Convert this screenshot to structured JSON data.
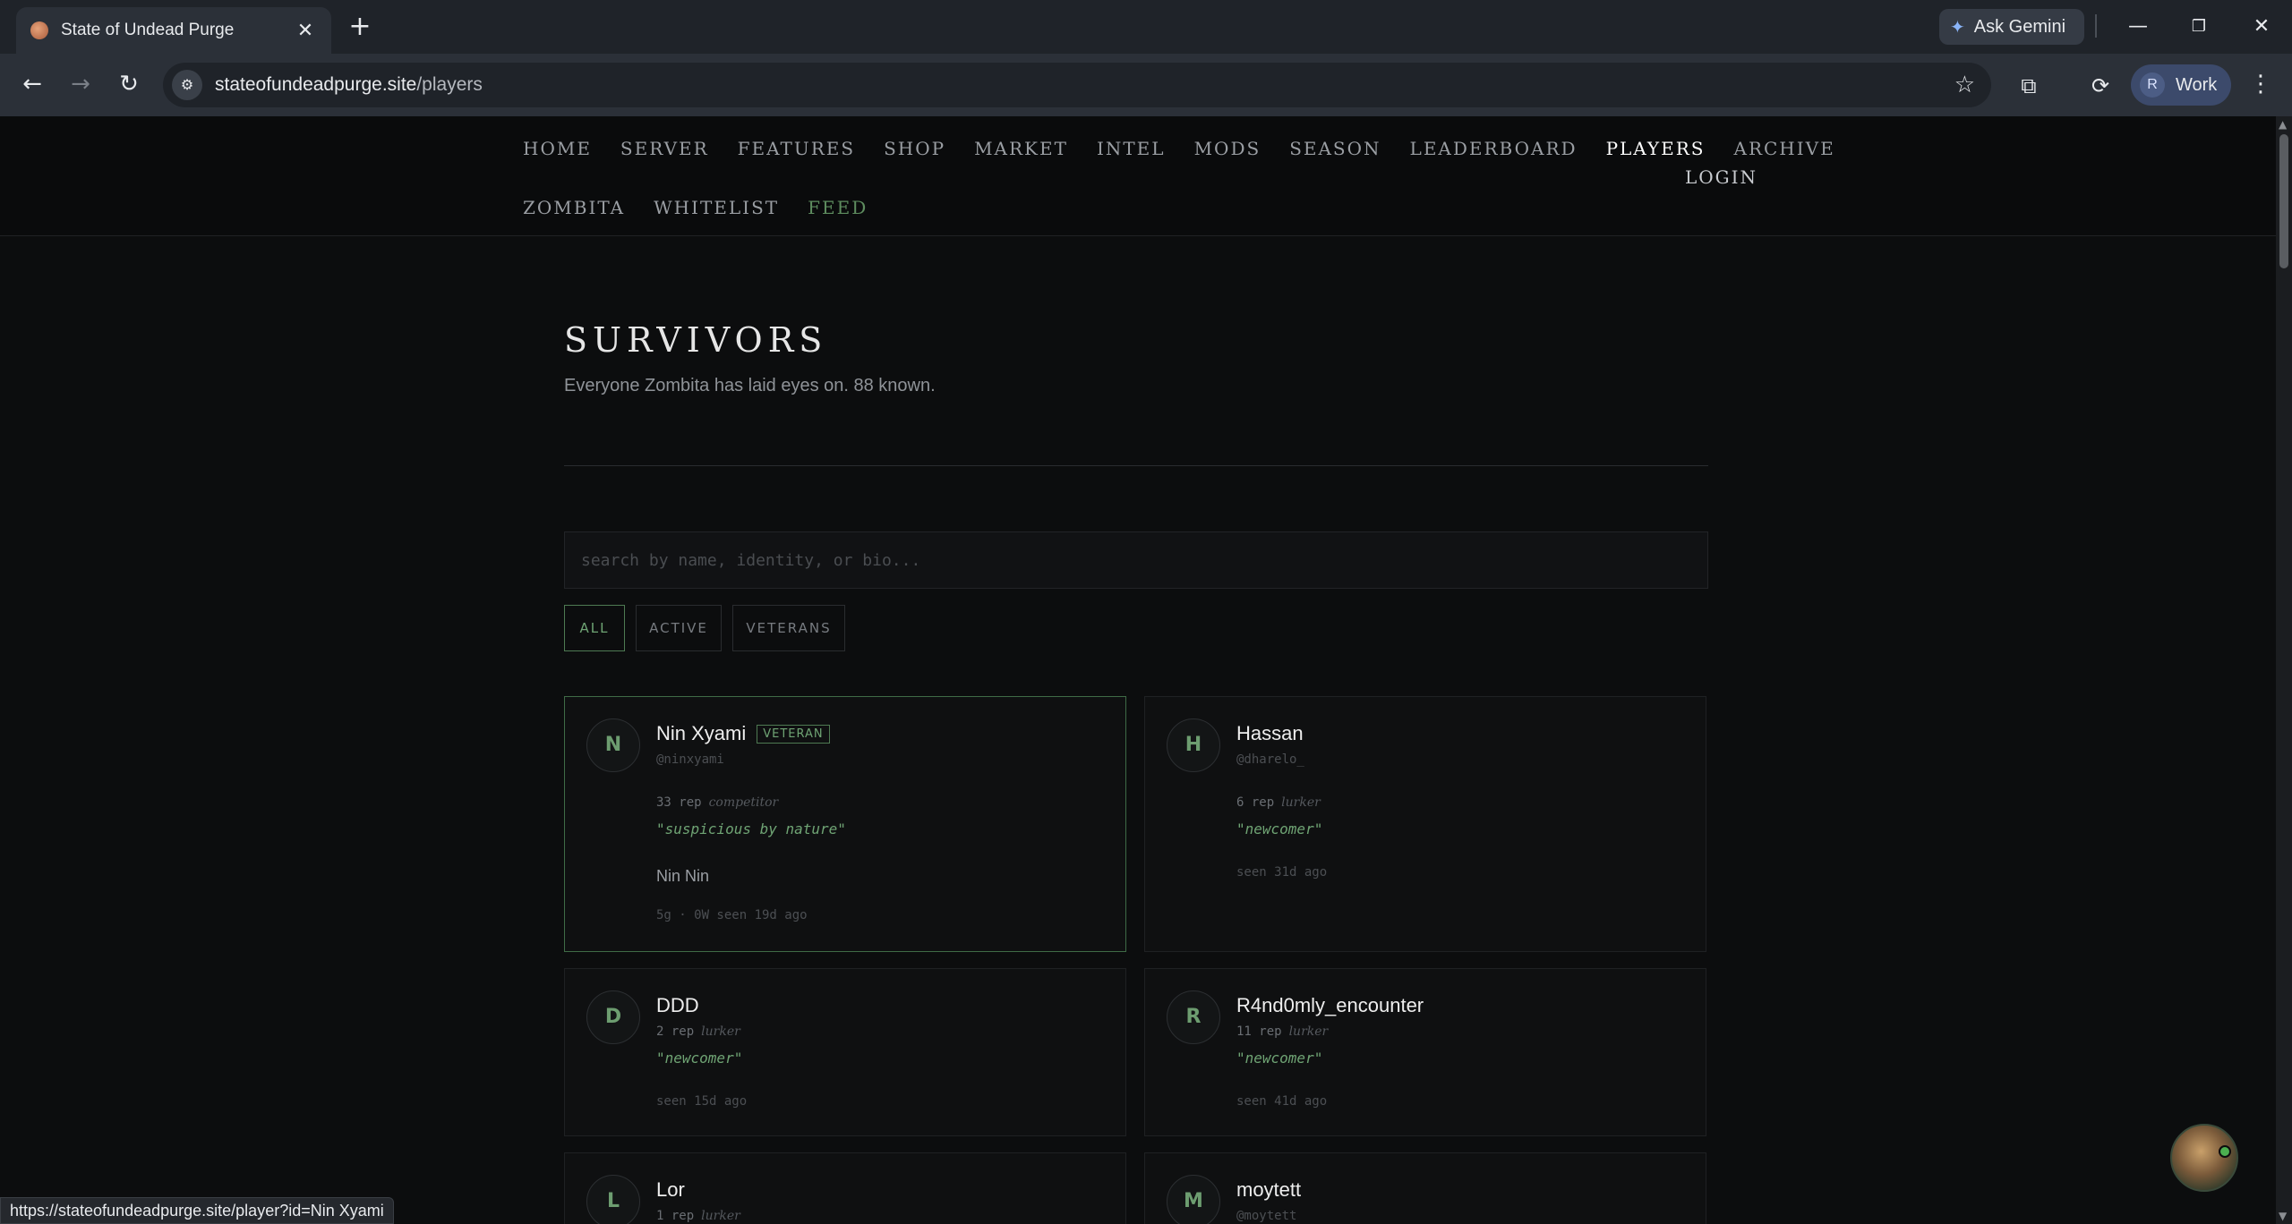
{
  "browser": {
    "tab_title": "State of Undead Purge",
    "url_host": "stateofundeadpurge.site",
    "url_path": "/players",
    "ask_gemini": "Ask Gemini",
    "profile_initial": "R",
    "profile_name": "Work",
    "status_url": "https://stateofundeadpurge.site/player?id=Nin Xyami"
  },
  "nav": {
    "row1": [
      "HOME",
      "SERVER",
      "FEATURES",
      "SHOP",
      "MARKET",
      "INTEL",
      "MODS",
      "SEASON",
      "LEADERBOARD",
      "PLAYERS",
      "ARCHIVE"
    ],
    "row2": [
      "ZOMBITA",
      "WHITELIST",
      "FEED"
    ],
    "login": "LOGIN",
    "active": "PLAYERS"
  },
  "page": {
    "title": "SURVIVORS",
    "subtitle": "Everyone Zombita has laid eyes on. 88 known.",
    "search_placeholder": "search by name, identity, or bio...",
    "filters": [
      "ALL",
      "ACTIVE",
      "VETERANS"
    ],
    "active_filter": "ALL"
  },
  "players": [
    {
      "initial": "N",
      "name": "Nin Xyami",
      "badge": "VETERAN",
      "handle": "@ninxyami",
      "rep": "33 rep",
      "role": "competitor",
      "quote": "\"suspicious by nature\"",
      "bio": "Nin Nin",
      "meta": "5g · 0W  seen 19d ago"
    },
    {
      "initial": "H",
      "name": "Hassan",
      "badge": "",
      "handle": "@dharelo_",
      "rep": "6 rep",
      "role": "lurker",
      "quote": "\"newcomer\"",
      "bio": "",
      "meta": "seen 31d ago"
    },
    {
      "initial": "D",
      "name": "DDD",
      "badge": "",
      "handle": "",
      "rep": "2 rep",
      "role": "lurker",
      "quote": "\"newcomer\"",
      "bio": "",
      "meta": "seen 15d ago"
    },
    {
      "initial": "R",
      "name": "R4nd0mly_encounter",
      "badge": "",
      "handle": "",
      "rep": "11 rep",
      "role": "lurker",
      "quote": "\"newcomer\"",
      "bio": "",
      "meta": "seen 41d ago"
    },
    {
      "initial": "L",
      "name": "Lor",
      "badge": "",
      "handle": "",
      "rep": "1 rep",
      "role": "lurker",
      "quote": "",
      "bio": "",
      "meta": ""
    },
    {
      "initial": "M",
      "name": "moytett",
      "badge": "",
      "handle": "@moytett",
      "rep": "",
      "role": "",
      "quote": "",
      "bio": "",
      "meta": ""
    }
  ]
}
